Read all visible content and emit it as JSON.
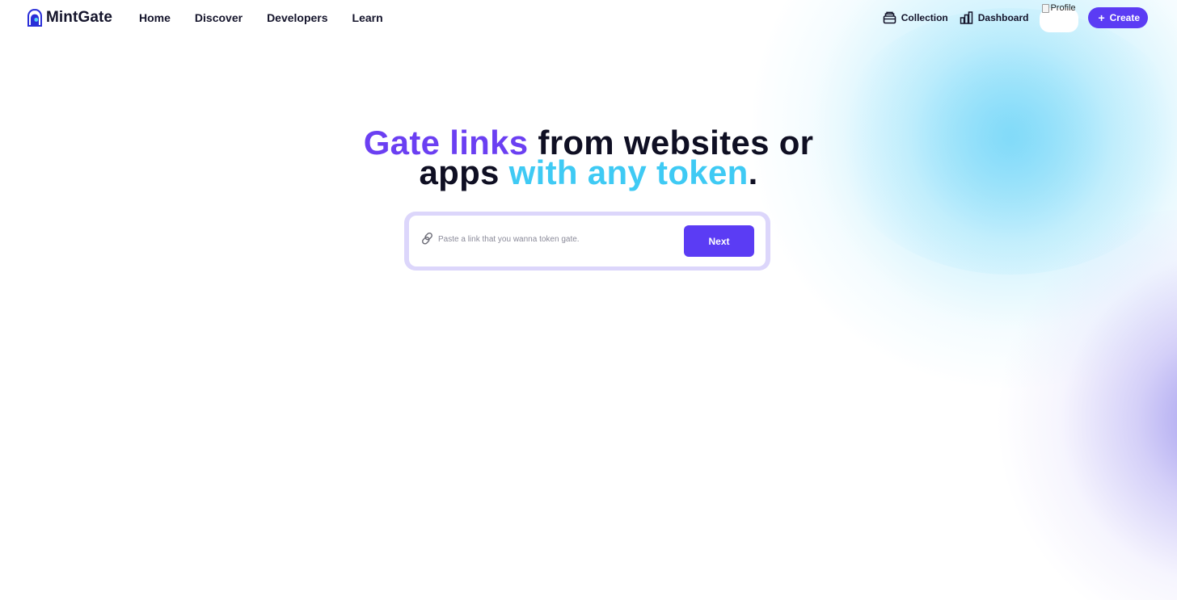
{
  "brand": {
    "name": "MintGate"
  },
  "nav": {
    "links": [
      "Home",
      "Discover",
      "Developers",
      "Learn"
    ],
    "collection_label": "Collection",
    "dashboard_label": "Dashboard",
    "profile_alt": "Profile",
    "create_label": "Create"
  },
  "hero": {
    "line1_highlight": "Gate links",
    "line1_rest": " from websites or",
    "line2_start": "apps ",
    "line2_highlight": "with any token",
    "line2_end": "."
  },
  "search": {
    "placeholder": "Paste a link that you wanna token gate.",
    "value": "",
    "button_label": "Next"
  },
  "icons": {
    "logo": "mintgate-logo-icon",
    "collection": "collection-icon",
    "dashboard": "dashboard-icon",
    "plus": "plus-icon",
    "link": "link-icon"
  },
  "colors": {
    "primary": "#5b3cf4",
    "highlight_purple": "#6b3ff2",
    "highlight_cyan": "#3fcaf4",
    "text_dark": "#0f0f23"
  }
}
